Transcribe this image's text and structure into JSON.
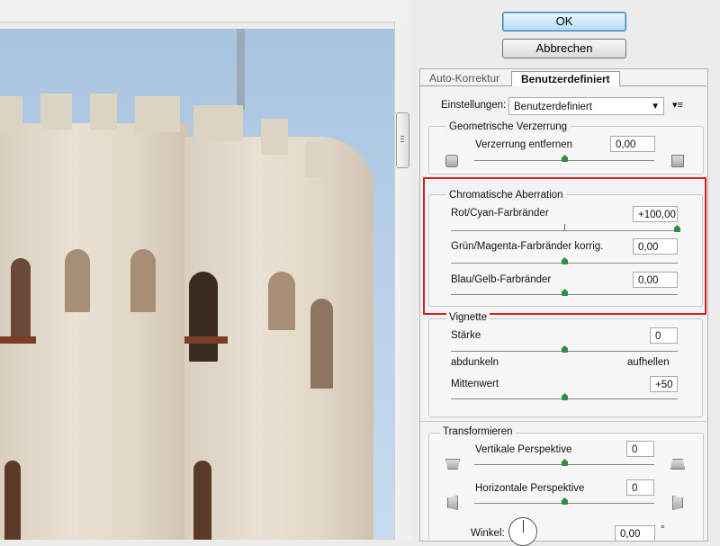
{
  "buttons": {
    "ok": "OK",
    "cancel": "Abbrechen"
  },
  "tabs": [
    {
      "label": "Auto-Korrektur",
      "active": false
    },
    {
      "label": "Benutzerdefiniert",
      "active": true
    }
  ],
  "settings": {
    "label": "Einstellungen:",
    "value": "Benutzerdefiniert"
  },
  "geometric": {
    "title": "Geometrische Verzerrung",
    "remove_distortion": {
      "label": "Verzerrung entfernen",
      "value": "0,00",
      "slider_fraction": 0.5
    }
  },
  "chromatic": {
    "title": "Chromatische Aberration",
    "red_cyan": {
      "label": "Rot/Cyan-Farbränder",
      "value": "+100,00",
      "slider_fraction": 1.0
    },
    "green_magenta": {
      "label": "Grün/Magenta-Farbränder korrig.",
      "value": "0,00",
      "slider_fraction": 0.5
    },
    "blue_yellow": {
      "label": "Blau/Gelb-Farbränder",
      "value": "0,00",
      "slider_fraction": 0.5
    }
  },
  "vignette": {
    "title": "Vignette",
    "amount": {
      "label": "Stärke",
      "value": "0",
      "slider_fraction": 0.5
    },
    "darken_label": "abdunkeln",
    "lighten_label": "aufhellen",
    "midpoint": {
      "label": "Mittenwert",
      "value": "+50",
      "slider_fraction": 0.5
    }
  },
  "transform": {
    "title": "Transformieren",
    "vertical": {
      "label": "Vertikale Perspektive",
      "value": "0",
      "slider_fraction": 0.5
    },
    "horizontal": {
      "label": "Horizontale Perspektive",
      "value": "0",
      "slider_fraction": 0.5
    },
    "angle": {
      "label": "Winkel:",
      "value": "0,00",
      "unit": "°"
    }
  },
  "colors": {
    "highlight": "#d92020",
    "slider_knob": "#2f8f3f",
    "ok_accent": "#3c7fb1"
  }
}
